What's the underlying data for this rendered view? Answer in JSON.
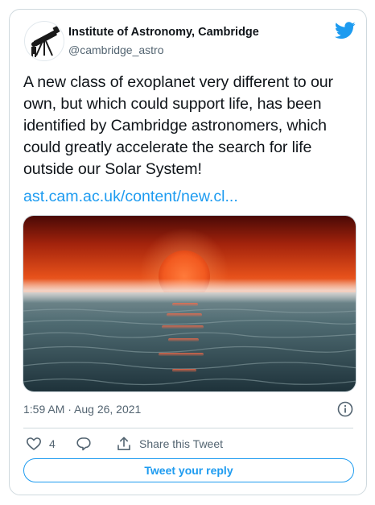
{
  "author": {
    "name": "Institute of Astronomy, Cambridge",
    "handle": "@cambridge_astro",
    "avatar_icon": "telescope-logo-icon"
  },
  "tweet": {
    "text": "A new class of exoplanet very different to our own, but which could support life, has been identified by Cambridge astronomers, which could greatly accelerate the search for life outside our Solar System!",
    "link": "ast.cam.ac.uk/content/new.cl...",
    "media_icon": "red-sun-over-ocean-image",
    "timestamp": "1:59 AM · Aug 26, 2021"
  },
  "actions": {
    "like_count": "4",
    "share_label": "Share this Tweet",
    "reply_button_label": "Tweet your reply"
  },
  "colors": {
    "accent": "#1d9bf0",
    "text": "#0f1419",
    "secondary": "#536471",
    "border": "#cfd9de"
  }
}
